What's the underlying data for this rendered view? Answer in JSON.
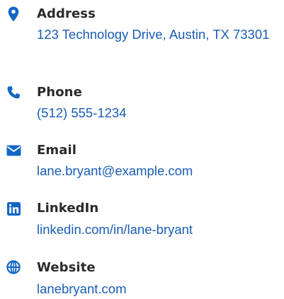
{
  "contact": {
    "accent_color": "#1166c4",
    "items": [
      {
        "icon": "map-pin-icon",
        "label": "Address",
        "value": "123 Technology Drive, Austin, TX 73301"
      },
      {
        "icon": "phone-icon",
        "label": "Phone",
        "value": "(512) 555-1234"
      },
      {
        "icon": "envelope-icon",
        "label": "Email",
        "value": "lane.bryant@example.com"
      },
      {
        "icon": "linkedin-icon",
        "label": "LinkedIn",
        "value": "linkedin.com/in/lane-bryant"
      },
      {
        "icon": "globe-icon",
        "label": "Website",
        "value": "lanebryant.com"
      }
    ]
  }
}
